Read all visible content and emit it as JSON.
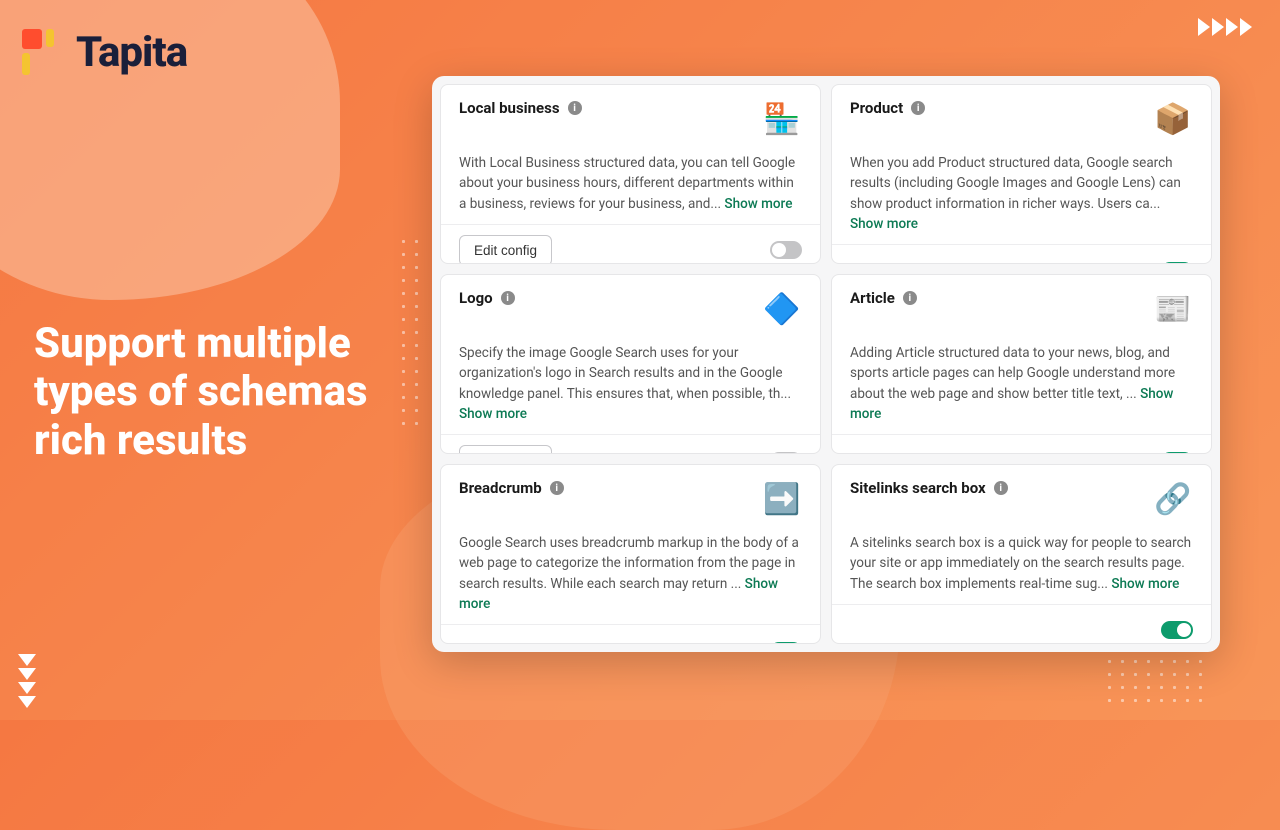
{
  "brand": {
    "name": "Tapita"
  },
  "headline": "Support multiple types of schemas rich results",
  "show_more_label": "Show more",
  "edit_config_label": "Edit config",
  "cards": [
    {
      "title": "Local business",
      "icon": "🏪",
      "desc": "With Local Business structured data, you can tell Google about your business hours, different departments within a business, reviews for your business, and... ",
      "edit_config": true,
      "enabled": false
    },
    {
      "title": "Product",
      "icon": "📦",
      "desc": "When you add Product structured data, Google search results (including Google Images and Google Lens) can show product information in richer ways. Users ca... ",
      "edit_config": false,
      "enabled": true
    },
    {
      "title": "Logo",
      "icon": "🔷",
      "desc": "Specify the image Google Search uses for your organization's logo in Search results and in the Google knowledge panel. This ensures that, when possible, th... ",
      "edit_config": true,
      "enabled": false
    },
    {
      "title": "Article",
      "icon": "📰",
      "desc": "Adding Article structured data to your news, blog, and sports article pages can help Google understand more about the web page and show better title text, ... ",
      "edit_config": false,
      "enabled": true
    },
    {
      "title": "Breadcrumb",
      "icon": "➡️",
      "desc": "Google Search uses breadcrumb markup in the body of a web page to categorize the information from the page in search results. While each search may return ... ",
      "edit_config": false,
      "enabled": true
    },
    {
      "title": "Sitelinks search box",
      "icon": "🔗",
      "desc": "A sitelinks search box is a quick way for people to search your site or app immediately on the search results page. The search box implements real-time sug... ",
      "edit_config": false,
      "enabled": true
    }
  ]
}
